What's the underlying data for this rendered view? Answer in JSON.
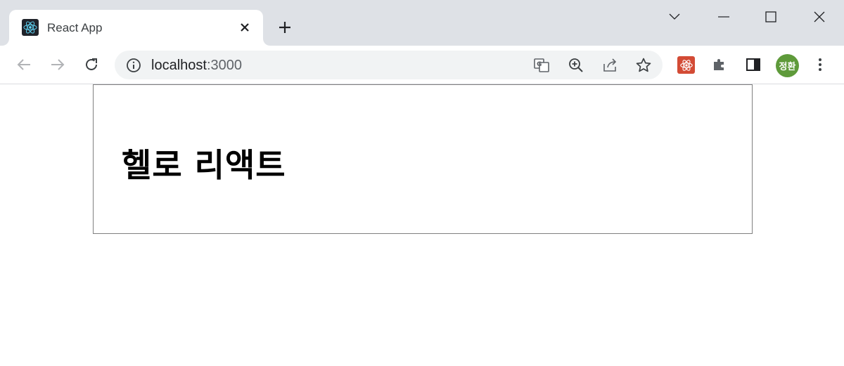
{
  "browser": {
    "tab": {
      "title": "React App",
      "favicon": "react-logo-icon"
    },
    "address": {
      "host": "localhost",
      "port": ":3000"
    },
    "profile": {
      "initials": "정환"
    },
    "colors": {
      "tabstrip": "#dee1e6",
      "omnibox": "#f1f3f4",
      "avatar": "#5e9a3a"
    }
  },
  "page": {
    "heading": "헬로 리액트"
  }
}
